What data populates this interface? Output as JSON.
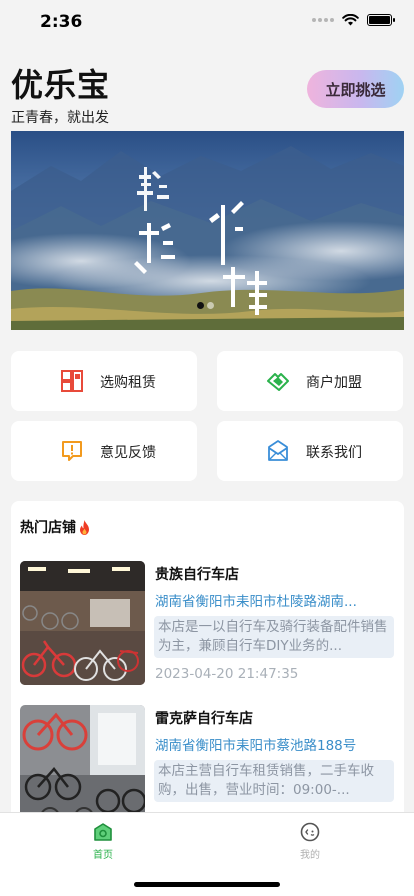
{
  "status_bar": {
    "time": "2:36"
  },
  "header": {
    "title": "优乐宝",
    "subtitle": "正青春，就出发",
    "cta_label": "立即挑选"
  },
  "banner": {
    "slide_count": 2,
    "active_index": 0
  },
  "menu": [
    {
      "label": "选购租赁",
      "icon": "grid-icon",
      "color": "#e84a3a"
    },
    {
      "label": "商户加盟",
      "icon": "handshake-icon",
      "color": "#2bb24c"
    },
    {
      "label": "意见反馈",
      "icon": "feedback-icon",
      "color": "#f29a1e"
    },
    {
      "label": "联系我们",
      "icon": "envelope-icon",
      "color": "#3a8ed8"
    }
  ],
  "hot_shops": {
    "title": "热门店铺",
    "icon": "fire-icon",
    "items": [
      {
        "name": "贵族自行车店",
        "address": "湖南省衡阳市耒阳市杜陵路湖南...",
        "description": "本店是一以自行车及骑行装备配件销售为主，兼顾自行车DIY业务的...",
        "time": "2023-04-20 21:47:35"
      },
      {
        "name": "雷克萨自行车店",
        "address": "湖南省衡阳市耒阳市蔡池路188号",
        "description": "本店主营自行车租赁销售，二手车收购，出售，营业时间：09:00-...",
        "time": ""
      }
    ]
  },
  "tab_bar": {
    "tabs": [
      {
        "label": "首页",
        "active": true,
        "icon": "home-icon"
      },
      {
        "label": "我的",
        "active": false,
        "icon": "profile-icon"
      }
    ],
    "active_color": "#2bb24c",
    "inactive_color": "#b0b0b0"
  }
}
